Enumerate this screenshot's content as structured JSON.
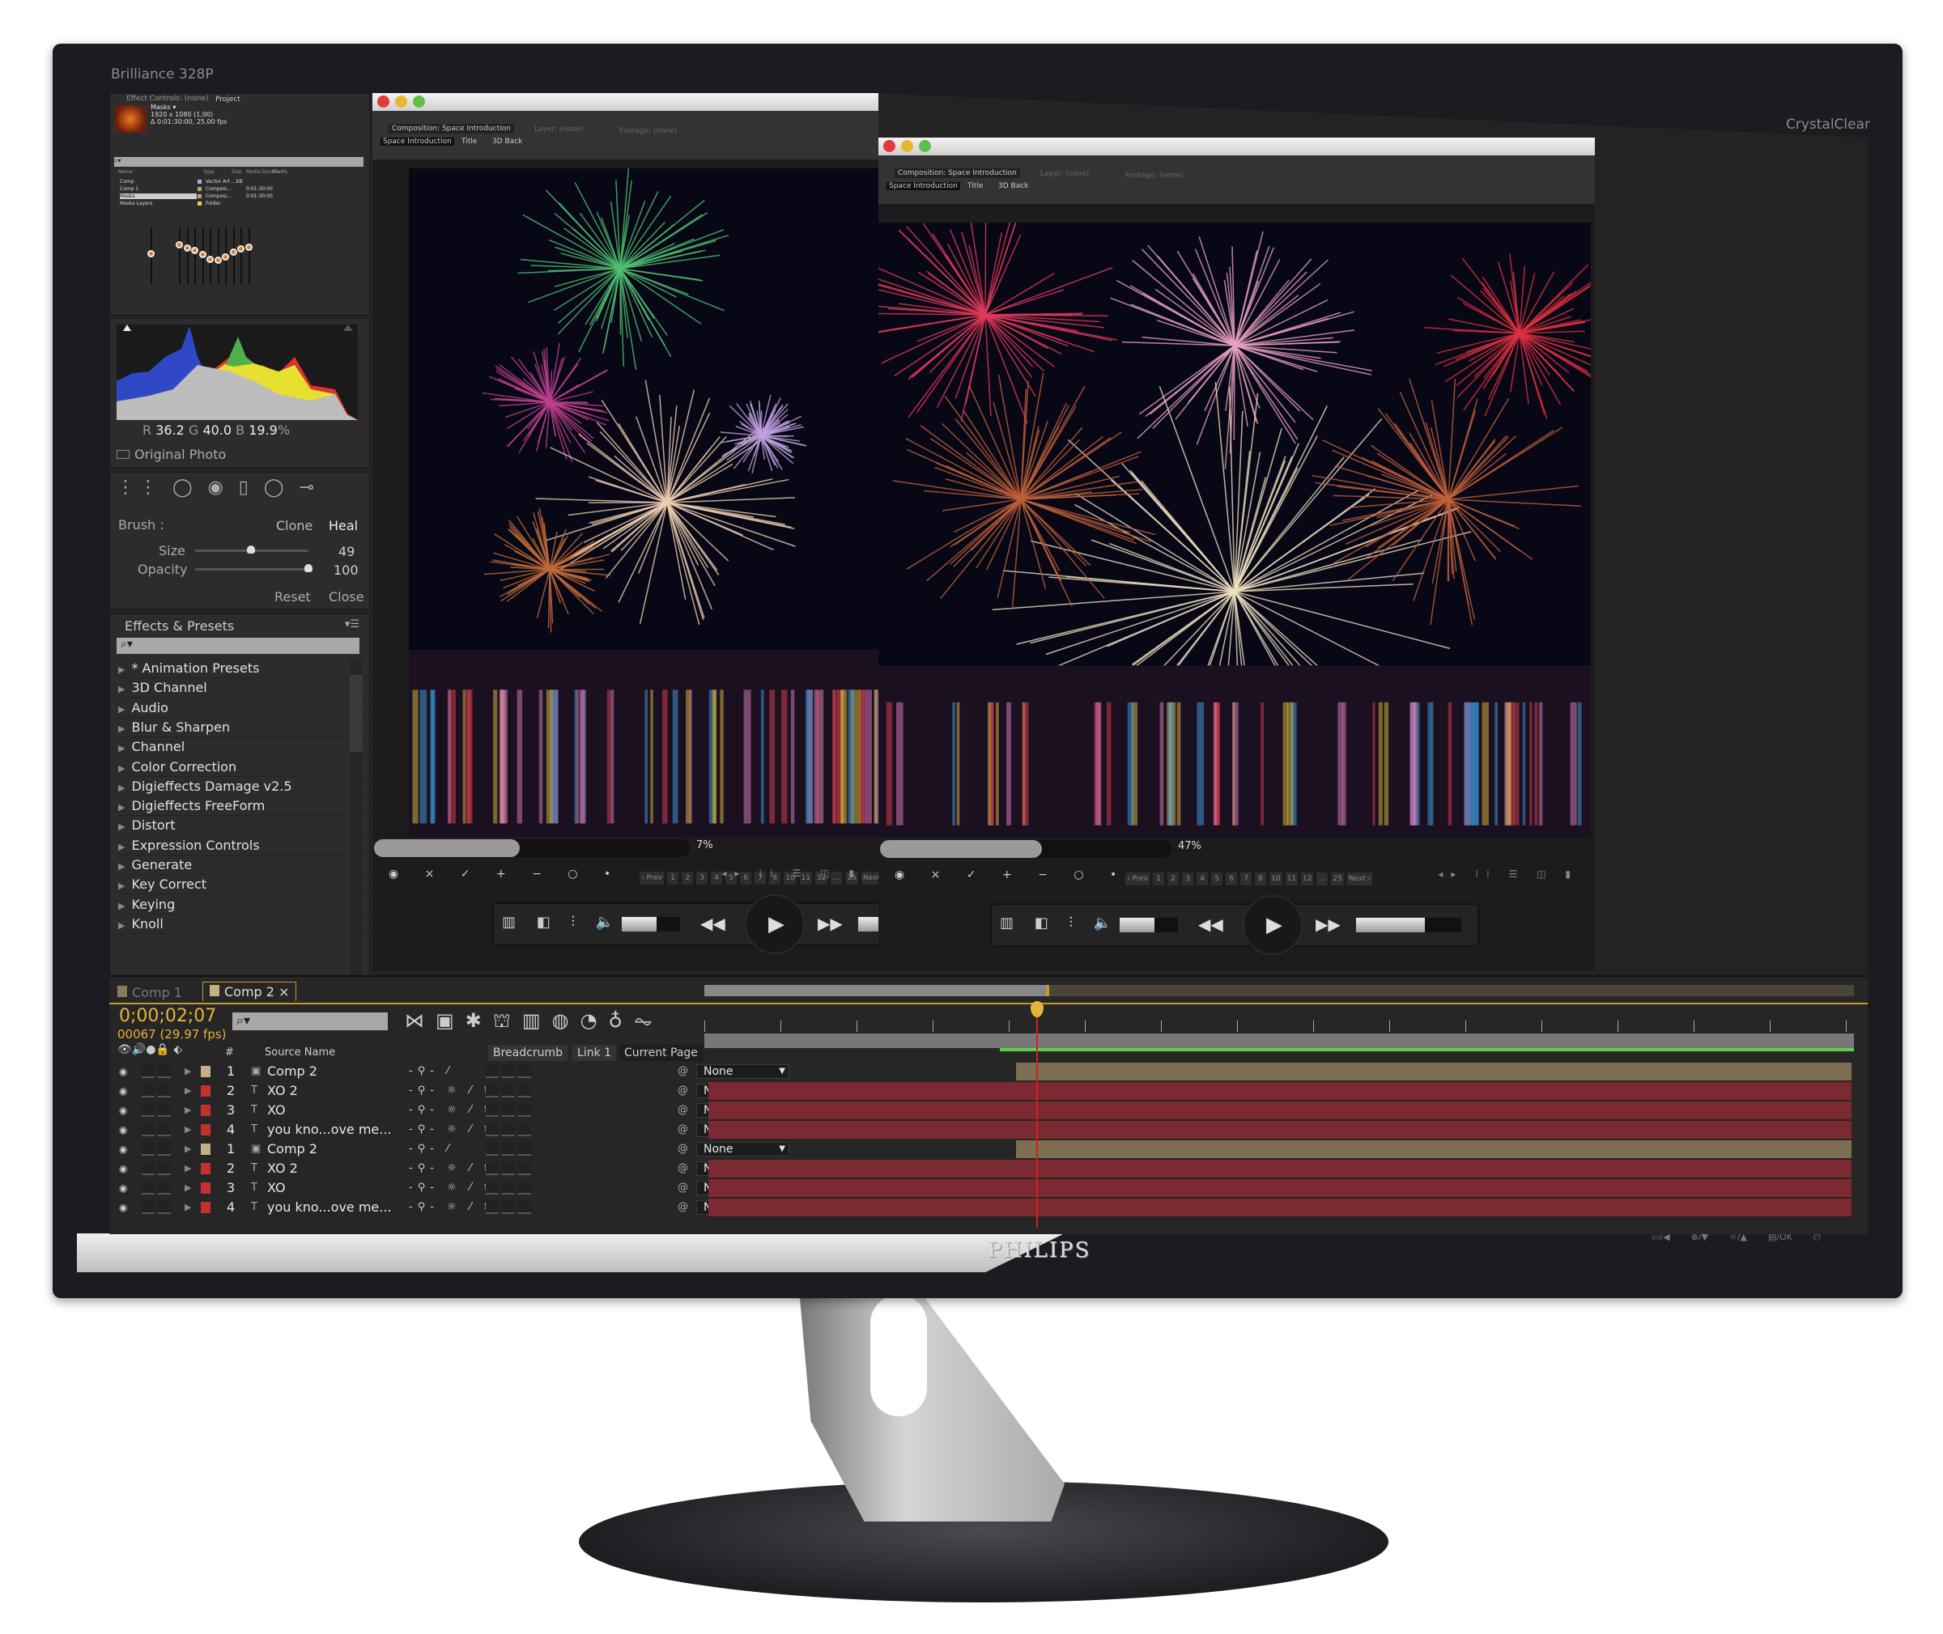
{
  "monitor": {
    "model": "Brilliance 328P",
    "feature": "CrystalClear",
    "brand": "PHILIPS",
    "buttons": [
      "▭/◀",
      "⊕/▼",
      "☼/▲",
      "▤/OK",
      "⏻"
    ]
  },
  "project": {
    "tabs": [
      "Effect Controls: (none)",
      "Project"
    ],
    "item_name": "Masks ▾",
    "resolution": "1920 x 1080 (1,00)",
    "duration": "Δ 0:01:30:00, 25,00 fps",
    "columns": [
      "Name",
      "Type",
      "Size",
      "Media Duration",
      "File Pa"
    ],
    "items": [
      {
        "name": "Comp",
        "type": "Vector Art",
        "size": "...KB",
        "dur": "",
        "color": "#a9a9e6"
      },
      {
        "name": "Comp 1",
        "type": "Composi...",
        "size": "",
        "dur": "0:01:30:00",
        "color": "#b8a47a"
      },
      {
        "name": "Masks",
        "type": "Composi...",
        "size": "",
        "dur": "0:01:30:00",
        "color": "#b8a47a"
      },
      {
        "name": "Masks Layers",
        "type": "Folder",
        "size": "",
        "dur": "",
        "color": "#e6d42a"
      }
    ]
  },
  "equalizer": {
    "preamp": 0.45,
    "bands": [
      0.3,
      0.35,
      0.4,
      0.47,
      0.55,
      0.57,
      0.51,
      0.43,
      0.37,
      0.34
    ]
  },
  "histogram": {
    "r_label": "R",
    "r": "36.2",
    "g_label": "G",
    "g": "40.0",
    "b_label": "B",
    "b": "19.9",
    "unit": "%",
    "original_label": "Original Photo"
  },
  "brush": {
    "label": "Brush :",
    "modes": [
      "Clone",
      "Heal"
    ],
    "size_label": "Size",
    "size": "49",
    "size_level": 0.49,
    "opacity_label": "Opacity",
    "opacity": "100",
    "opacity_level": 1.0,
    "reset": "Reset",
    "close": "Close"
  },
  "effects": {
    "title": "Effects & Presets",
    "items": [
      "* Animation Presets",
      "3D Channel",
      "Audio",
      "Blur & Sharpen",
      "Channel",
      "Color Correction",
      "Digieffects Damage v2.5",
      "Digieffects FreeForm",
      "Distort",
      "Expression Controls",
      "Generate",
      "Key Correct",
      "Keying",
      "Knoll"
    ]
  },
  "viewers": [
    {
      "composition": "Composition: Space Introduction",
      "layer": "Layer: (none)",
      "footage": "Footage: (none)",
      "crumbs": [
        "Space Introduction",
        "Title",
        "3D Back"
      ],
      "zoom": "7%",
      "zoom_level": 0.07
    },
    {
      "composition": "Composition: Space Introduction",
      "layer": "Layer: (none)",
      "footage": "Footage: (none)",
      "crumbs": [
        "Space Introduction",
        "Title",
        "3D Back"
      ],
      "zoom": "47%",
      "zoom_level": 0.47
    }
  ],
  "pagination": {
    "prev": "‹ Prev",
    "pages": [
      "1",
      "2",
      "3",
      "4",
      "5",
      "6",
      "7",
      "8",
      "10",
      "11",
      "12",
      "...",
      "25"
    ],
    "next": "Next ›"
  },
  "player": {
    "volume": 0.6,
    "progress": 0.65
  },
  "timeline": {
    "tabs": [
      "Comp 1",
      "Comp 2"
    ],
    "timecode": "0;00;02;07",
    "frames": "00067 (29.97 fps)",
    "source_header": "Source Name",
    "num_header": "#",
    "crumbs": [
      "Breadcrumb",
      "Link 1",
      "Current Page"
    ],
    "rows": [
      {
        "num": "1",
        "name": "Comp 2",
        "kind": "comp",
        "color": "#c4b087"
      },
      {
        "num": "2",
        "name": "XO 2",
        "kind": "text",
        "color": "#c4302e"
      },
      {
        "num": "3",
        "name": "XO",
        "kind": "text",
        "color": "#c4302e"
      },
      {
        "num": "4",
        "name": "you kno...ove me...",
        "kind": "text",
        "color": "#c4302e"
      },
      {
        "num": "1",
        "name": "Comp 2",
        "kind": "comp",
        "color": "#c4b087"
      },
      {
        "num": "2",
        "name": "XO 2",
        "kind": "text",
        "color": "#c4302e"
      },
      {
        "num": "3",
        "name": "XO",
        "kind": "text",
        "color": "#c4302e"
      },
      {
        "num": "4",
        "name": "you kno...ove me...",
        "kind": "text",
        "color": "#c4302e"
      }
    ],
    "parent": "None"
  },
  "colors": {
    "accent": "#e6b43a",
    "layer_red": "#7a2a30",
    "layer_tan": "#7d6e52",
    "work_green": "#5fd04a"
  }
}
